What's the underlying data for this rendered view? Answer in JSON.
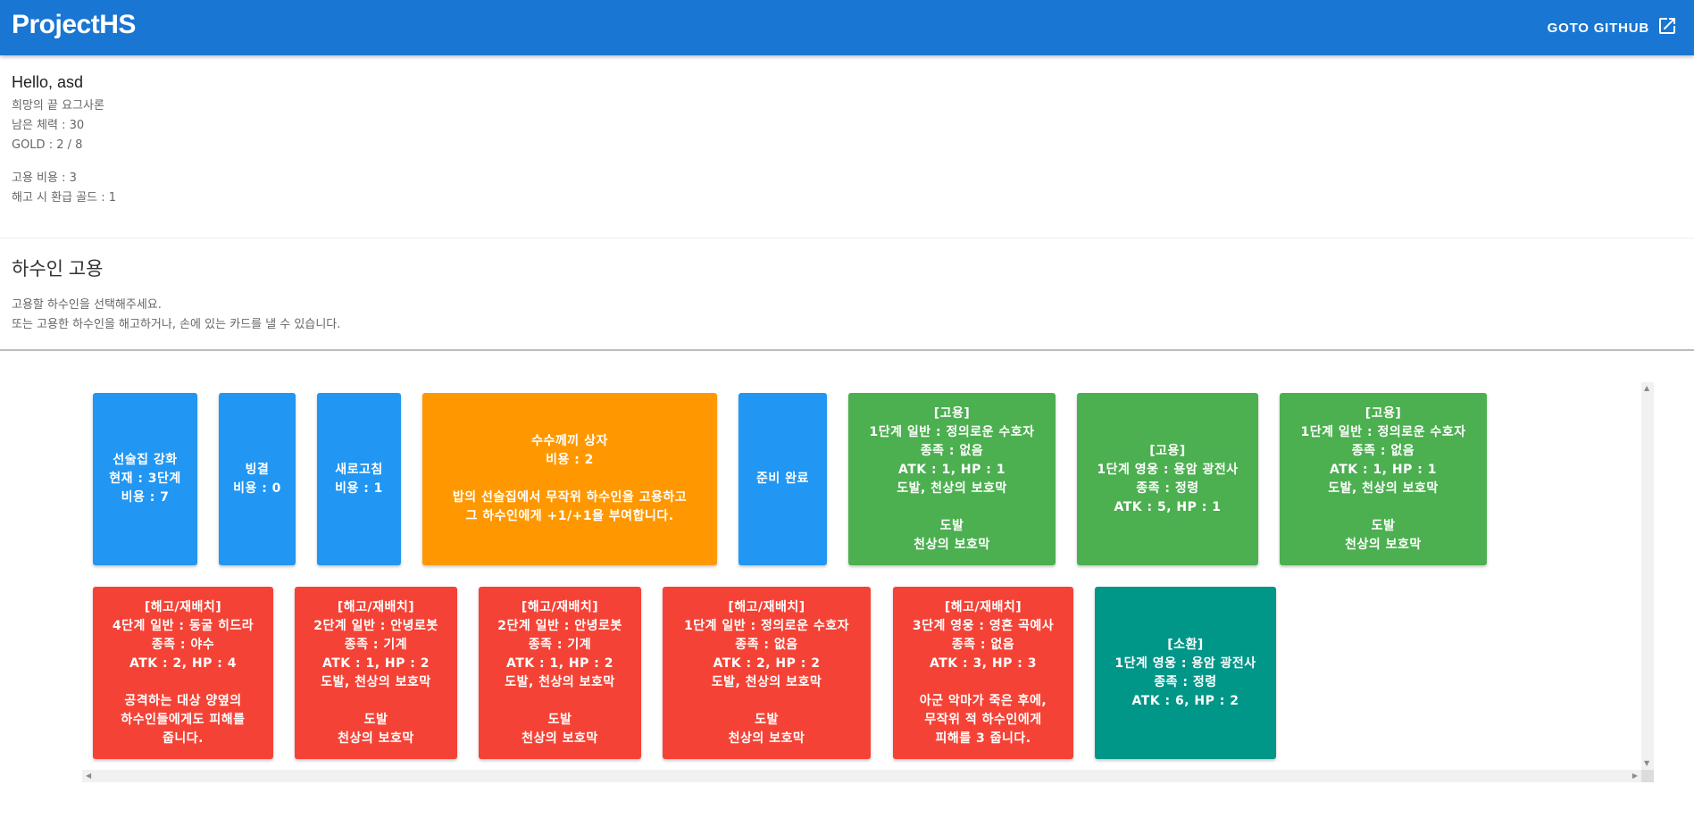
{
  "appbar": {
    "title": "ProjectHS",
    "github_label": "GOTO GITHUB"
  },
  "player": {
    "greeting": "Hello, asd",
    "hero": "희망의 끝 요그사론",
    "health": "남은 체력 : 30",
    "gold": "GOLD : 2 / 8",
    "hire_cost": "고용 비용 : 3",
    "refund_gold": "해고 시 환급 골드 : 1"
  },
  "section": {
    "title": "하수인 고용",
    "instruction_1": "고용할 하수인을 선택해주세요.",
    "instruction_2": "또는 고용한 하수인을 해고하거나, 손에 있는 카드를 낼 수 있습니다."
  },
  "colors": {
    "appbar": "#1976d2",
    "action": "#2196f3",
    "spell": "#ff9800",
    "hire": "#4caf50",
    "sell": "#f44336",
    "summon": "#009688"
  },
  "icons": {
    "github_link": "open-in-new-icon"
  },
  "row1": [
    {
      "kind": "action",
      "text": "선술집 강화\n현재 : 3단계\n비용 : 7"
    },
    {
      "kind": "action",
      "text": "빙결\n비용 : 0"
    },
    {
      "kind": "action",
      "text": "새로고침\n비용 : 1"
    },
    {
      "kind": "spell",
      "title": "수수께끼 상자\n비용 : 2",
      "desc": "밥의 선술집에서 무작위 하수인을 고용하고\n그 하수인에게 +1/+1을 부여합니다."
    },
    {
      "kind": "action",
      "text": "준비 완료"
    },
    {
      "kind": "hire",
      "text": "[고용]\n1단계 일반 : 정의로운 수호자\n종족 : 없음\nATK : 1, HP : 1\n도발, 천상의 보호막\n\n도발\n천상의 보호막"
    },
    {
      "kind": "hire",
      "text": "[고용]\n1단계 영웅 : 용암 광전사\n종족 : 정령\nATK : 5, HP : 1"
    },
    {
      "kind": "hire",
      "text": "[고용]\n1단계 일반 : 정의로운 수호자\n종족 : 없음\nATK : 1, HP : 1\n도발, 천상의 보호막\n\n도발\n천상의 보호막"
    }
  ],
  "row2": [
    {
      "kind": "sell",
      "text": "[해고/재배치]\n4단계 일반 : 동굴 히드라\n종족 : 야수\nATK : 2, HP : 4\n\n공격하는 대상 양옆의\n하수인들에게도 피해를\n줍니다."
    },
    {
      "kind": "sell",
      "text": "[해고/재배치]\n2단계 일반 : 안녕로봇\n종족 : 기계\nATK : 1, HP : 2\n도발, 천상의 보호막\n\n도발\n천상의 보호막"
    },
    {
      "kind": "sell",
      "text": "[해고/재배치]\n2단계 일반 : 안녕로봇\n종족 : 기계\nATK : 1, HP : 2\n도발, 천상의 보호막\n\n도발\n천상의 보호막"
    },
    {
      "kind": "sell",
      "text": "[해고/재배치]\n1단계 일반 : 정의로운 수호자\n종족 : 없음\nATK : 2, HP : 2\n도발, 천상의 보호막\n\n도발\n천상의 보호막"
    },
    {
      "kind": "sell",
      "text": "[해고/재배치]\n3단계 영웅 : 영혼 곡예사\n종족 : 없음\nATK : 3, HP : 3\n\n아군 악마가 죽은 후에,\n무작위 적 하수인에게\n피해를 3 줍니다."
    },
    {
      "kind": "summon",
      "text": "[소환]\n1단계 영웅 : 용암 광전사\n종족 : 정령\nATK : 6, HP : 2"
    }
  ]
}
